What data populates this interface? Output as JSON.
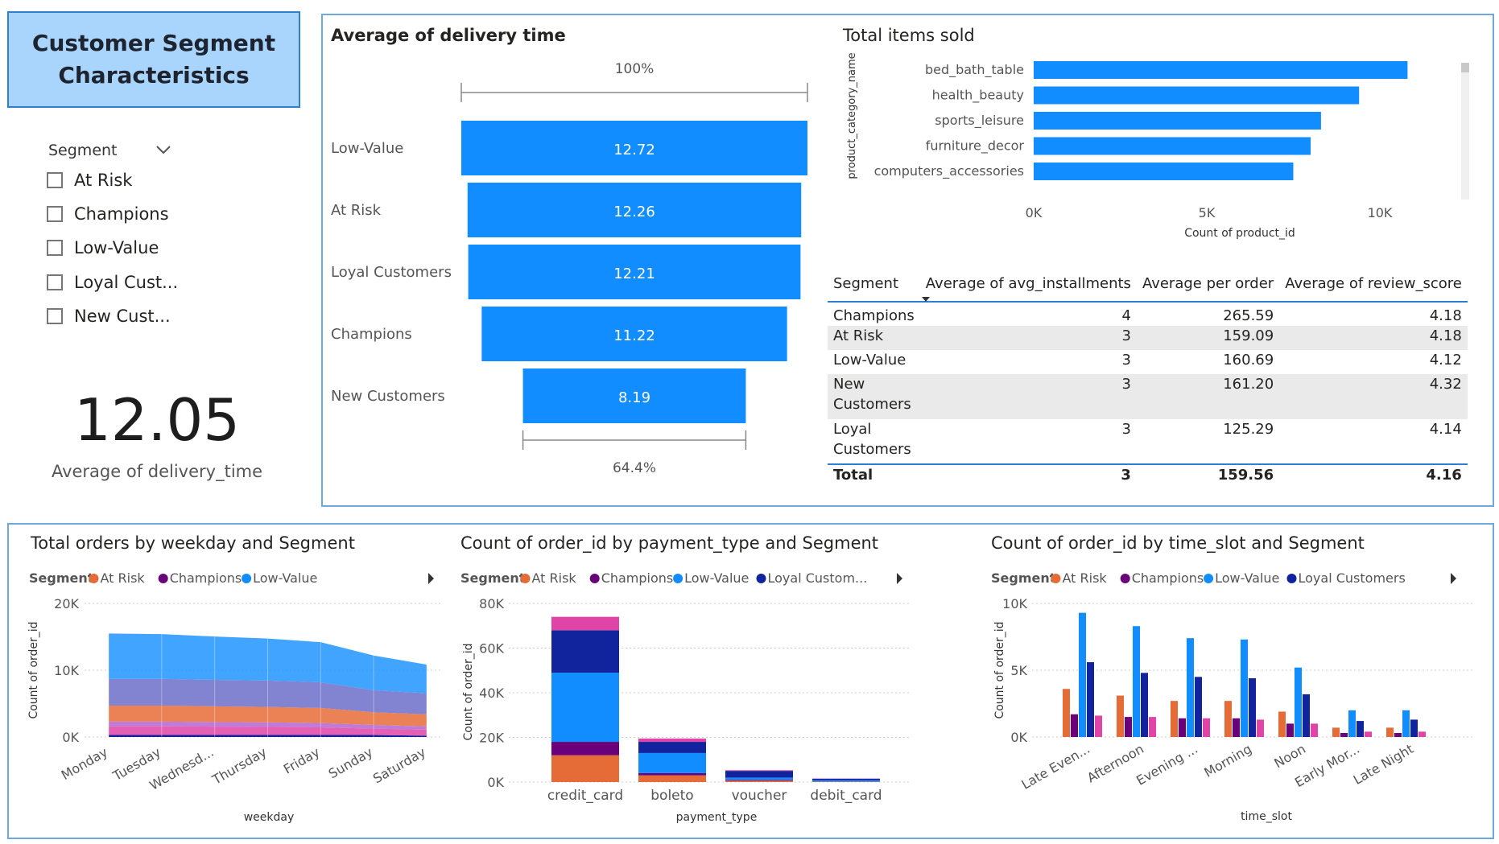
{
  "title": {
    "line1": "Customer Segment",
    "line2": "Characteristics"
  },
  "slicer": {
    "label": "Segment",
    "icon": "chevron-down-icon",
    "items": [
      "At Risk",
      "Champions",
      "Low-Value",
      "Loyal Cust...",
      "New Cust..."
    ]
  },
  "kpi": {
    "value": "12.05",
    "label": "Average of delivery_time"
  },
  "colors": {
    "accent": "#118dff",
    "at_risk": "#e66c37",
    "champions": "#6b007b",
    "low_value": "#118dff",
    "loyal": "#12239e",
    "new": "#e044a7",
    "panel_border": "#6fa8e0"
  },
  "funnel": {
    "title": "Average of delivery time",
    "top_label": "100%",
    "bottom_label": "64.4%"
  },
  "items_sold": {
    "title": "Total items sold",
    "ylabel": "product_category_name",
    "xlabel": "Count of product_id"
  },
  "table": {
    "headers": [
      "Segment",
      "Average of avg_installments",
      "Average per order",
      "Average of review_score"
    ],
    "rows": [
      {
        "segment": "Champions",
        "installments": "4",
        "per_order": "265.59",
        "review": "4.18"
      },
      {
        "segment": "At Risk",
        "installments": "3",
        "per_order": "159.09",
        "review": "4.18"
      },
      {
        "segment": "Low-Value",
        "installments": "3",
        "per_order": "160.69",
        "review": "4.12"
      },
      {
        "segment": "New Customers",
        "installments": "3",
        "per_order": "161.20",
        "review": "4.32"
      },
      {
        "segment": "Loyal Customers",
        "installments": "3",
        "per_order": "125.29",
        "review": "4.14"
      }
    ],
    "total": {
      "segment": "Total",
      "installments": "3",
      "per_order": "159.56",
      "review": "4.16"
    }
  },
  "weekday_chart": {
    "title": "Total orders by weekday and Segment",
    "legend_label": "Segment",
    "legend": [
      "At Risk",
      "Champions",
      "Low-Value"
    ]
  },
  "payment_chart": {
    "title": "Count of order_id by payment_type and Segment",
    "legend_label": "Segment",
    "legend": [
      "At Risk",
      "Champions",
      "Low-Value",
      "Loyal Custom..."
    ]
  },
  "timeslot_chart": {
    "title": "Count of order_id by time_slot and Segment",
    "legend_label": "Segment",
    "legend": [
      "At Risk",
      "Champions",
      "Low-Value",
      "Loyal Customers"
    ]
  },
  "chart_data": [
    {
      "type": "bar",
      "orientation": "funnel",
      "title": "Average of delivery time",
      "categories": [
        "Low-Value",
        "At Risk",
        "Loyal Customers",
        "Champions",
        "New Customers"
      ],
      "values": [
        12.72,
        12.26,
        12.21,
        11.22,
        8.19
      ],
      "value_labels": [
        "12.72",
        "12.26",
        "12.21",
        "11.22",
        "8.19"
      ]
    },
    {
      "type": "bar",
      "orientation": "horizontal",
      "title": "Total items sold",
      "categories": [
        "bed_bath_table",
        "health_beauty",
        "sports_leisure",
        "furniture_decor",
        "computers_accessories"
      ],
      "values": [
        10800,
        9400,
        8300,
        8000,
        7500
      ],
      "xlabel": "Count of product_id",
      "ylabel": "product_category_name",
      "xlim": [
        0,
        12000
      ],
      "xticks": [
        "0K",
        "5K",
        "10K"
      ]
    },
    {
      "type": "area",
      "stacked": true,
      "title": "Total orders by weekday and Segment",
      "categories": [
        "Monday",
        "Tuesday",
        "Wednesd...",
        "Thursday",
        "Friday",
        "Sunday",
        "Saturday"
      ],
      "series": [
        {
          "name": "Loyal Customers",
          "values": [
            300,
            300,
            300,
            300,
            300,
            300,
            200
          ]
        },
        {
          "name": "New Customers",
          "values": [
            1300,
            1300,
            1250,
            1200,
            1150,
            950,
            900
          ]
        },
        {
          "name": "Champions",
          "values": [
            700,
            700,
            700,
            700,
            650,
            550,
            500
          ]
        },
        {
          "name": "At Risk",
          "values": [
            2400,
            2400,
            2350,
            2300,
            2250,
            1900,
            1800
          ]
        },
        {
          "name": "Low-Value",
          "values": [
            4000,
            4000,
            3950,
            3950,
            3850,
            3300,
            3150
          ]
        },
        {
          "name": "Loyal Customers",
          "values": [
            6800,
            6700,
            6500,
            6300,
            6000,
            5200,
            4300
          ]
        }
      ],
      "xlabel": "weekday",
      "ylabel": "Count of order_id",
      "ylim": [
        0,
        20000
      ],
      "yticks": [
        "0K",
        "10K",
        "20K"
      ]
    },
    {
      "type": "bar",
      "stacked": true,
      "title": "Count of order_id by payment_type and Segment",
      "categories": [
        "credit_card",
        "boleto",
        "voucher",
        "debit_card"
      ],
      "series": [
        {
          "name": "At Risk",
          "values": [
            12000,
            3000,
            600,
            200
          ]
        },
        {
          "name": "Champions",
          "values": [
            6000,
            1000,
            400,
            100
          ]
        },
        {
          "name": "Low-Value",
          "values": [
            31000,
            9000,
            1000,
            600
          ]
        },
        {
          "name": "Loyal Customers",
          "values": [
            19000,
            5000,
            3000,
            600
          ]
        },
        {
          "name": "New Customers",
          "values": [
            6000,
            1500,
            300,
            100
          ]
        }
      ],
      "xlabel": "payment_type",
      "ylabel": "Count of order_id",
      "ylim": [
        0,
        80000
      ],
      "yticks": [
        "0K",
        "20K",
        "40K",
        "60K",
        "80K"
      ]
    },
    {
      "type": "bar",
      "grouped": true,
      "title": "Count of order_id by time_slot and Segment",
      "categories": [
        "Late Even...",
        "Afternoon",
        "Evening ...",
        "Morning",
        "Noon",
        "Early Mor...",
        "Late Night"
      ],
      "series": [
        {
          "name": "At Risk",
          "values": [
            3600,
            3100,
            2700,
            2700,
            1900,
            700,
            700
          ]
        },
        {
          "name": "Champions",
          "values": [
            1700,
            1500,
            1400,
            1400,
            1000,
            300,
            300
          ]
        },
        {
          "name": "Low-Value",
          "values": [
            9300,
            8300,
            7400,
            7300,
            5200,
            2000,
            2000
          ]
        },
        {
          "name": "Loyal Customers",
          "values": [
            5600,
            4800,
            4500,
            4400,
            3200,
            1200,
            1300
          ]
        },
        {
          "name": "New Customers",
          "values": [
            1600,
            1500,
            1400,
            1300,
            1000,
            400,
            400
          ]
        }
      ],
      "xlabel": "time_slot",
      "ylabel": "Count of order_id",
      "ylim": [
        0,
        10000
      ],
      "yticks": [
        "0K",
        "5K",
        "10K"
      ]
    }
  ]
}
